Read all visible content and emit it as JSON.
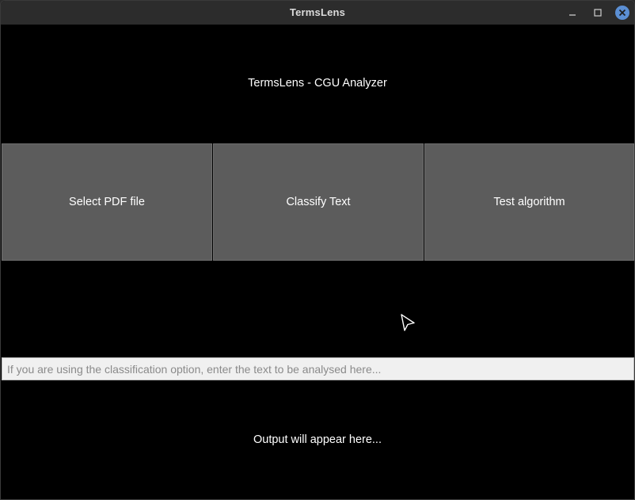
{
  "window": {
    "title": "TermsLens",
    "controls": {
      "minimize_icon": "minimize-icon",
      "maximize_icon": "maximize-icon",
      "close_icon": "close-icon"
    },
    "close_color": "#5b8fd4"
  },
  "main": {
    "heading": "TermsLens - CGU Analyzer",
    "buttons": [
      {
        "label": "Select PDF file"
      },
      {
        "label": "Classify Text"
      },
      {
        "label": "Test algorithm"
      }
    ],
    "input": {
      "value": "",
      "placeholder": "If you are using the classification option, enter the text to be analysed here..."
    },
    "output": "Output will appear here..."
  },
  "colors": {
    "background": "#000000",
    "button": "#5c5c5c",
    "input_background": "#f0f0f0",
    "titlebar": "#2c2c2c"
  }
}
